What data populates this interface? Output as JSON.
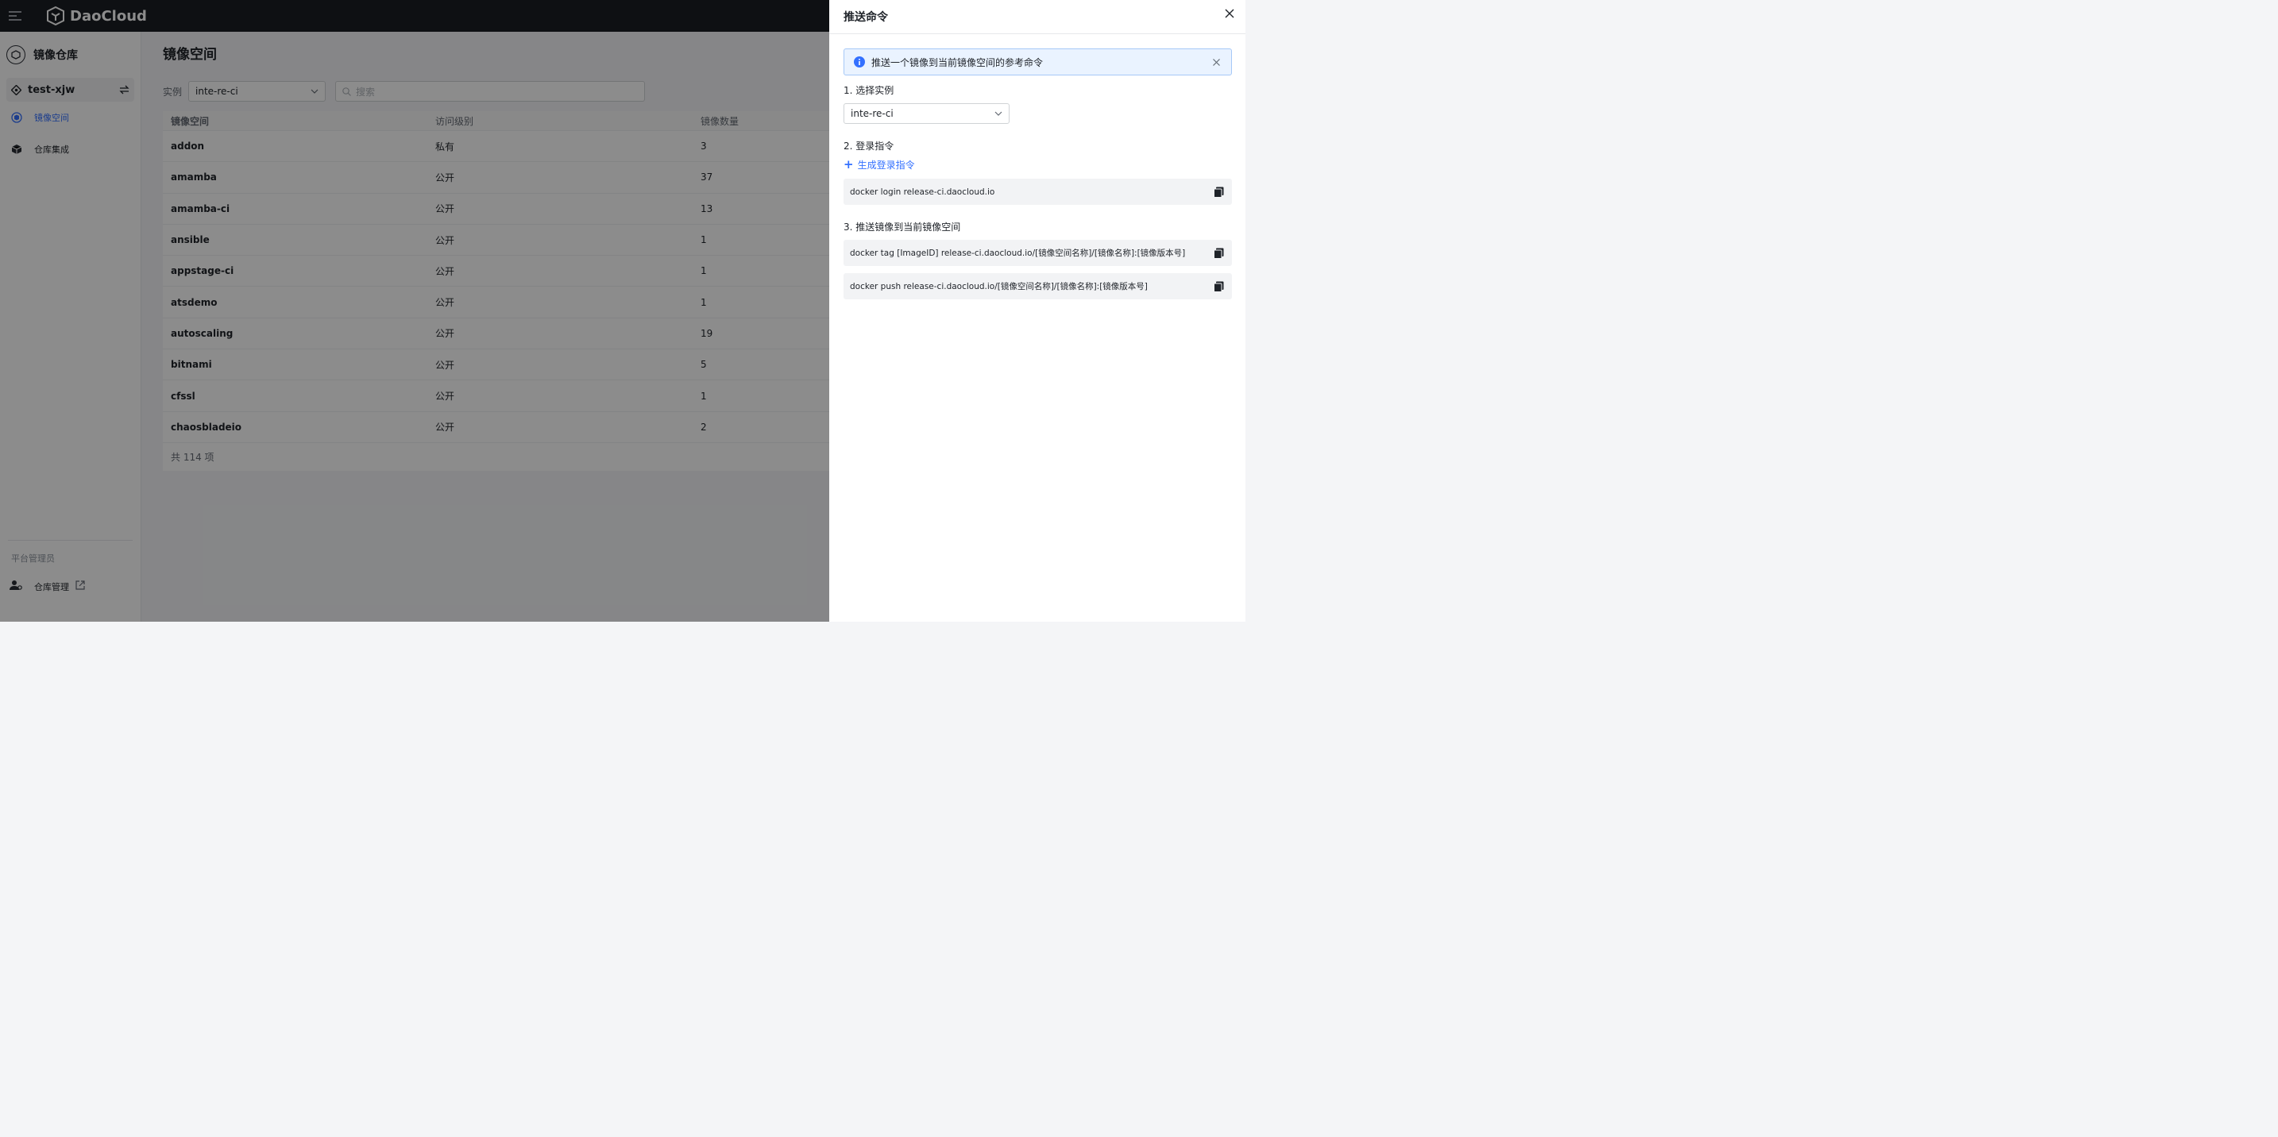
{
  "brand": {
    "name": "DaoCloud"
  },
  "sidebar": {
    "module_title": "镜像仓库",
    "workspace": "test-xjw",
    "items": [
      {
        "label": "镜像空间",
        "active": true
      },
      {
        "label": "仓库集成",
        "active": false
      }
    ],
    "group_label": "平台管理员",
    "admin_item": "仓库管理"
  },
  "main": {
    "title": "镜像空间",
    "filter_label": "实例",
    "instance_value": "inte-re-ci",
    "search_placeholder": "搜索",
    "table": {
      "columns": [
        "镜像空间",
        "访问级别",
        "镜像数量"
      ],
      "rows": [
        [
          "addon",
          "私有",
          "3"
        ],
        [
          "amamba",
          "公开",
          "37"
        ],
        [
          "amamba-ci",
          "公开",
          "13"
        ],
        [
          "ansible",
          "公开",
          "1"
        ],
        [
          "appstage-ci",
          "公开",
          "1"
        ],
        [
          "atsdemo",
          "公开",
          "1"
        ],
        [
          "autoscaling",
          "公开",
          "19"
        ],
        [
          "bitnami",
          "公开",
          "5"
        ],
        [
          "cfssl",
          "公开",
          "1"
        ],
        [
          "chaosbladeio",
          "公开",
          "2"
        ]
      ],
      "total": "共 114 项"
    }
  },
  "drawer": {
    "title": "推送命令",
    "alert": "推送一个镜像到当前镜像空间的参考命令",
    "step1": "1. 选择实例",
    "instance": "inte-re-ci",
    "step2": "2. 登录指令",
    "gen_login": "生成登录指令",
    "login_cmd": "docker login release-ci.daocloud.io",
    "step3": "3. 推送镜像到当前镜像空间",
    "tag_cmd": "docker tag [ImageID] release-ci.daocloud.io/[镜像空间名称]/[镜像名称]:[镜像版本号]",
    "push_cmd": "docker push release-ci.daocloud.io/[镜像空间名称]/[镜像名称]:[镜像版本号]"
  },
  "colors": {
    "accent": "#3370ff",
    "topbar": "#1b1e24",
    "overlay": "rgba(0,0,0,0.45)"
  }
}
